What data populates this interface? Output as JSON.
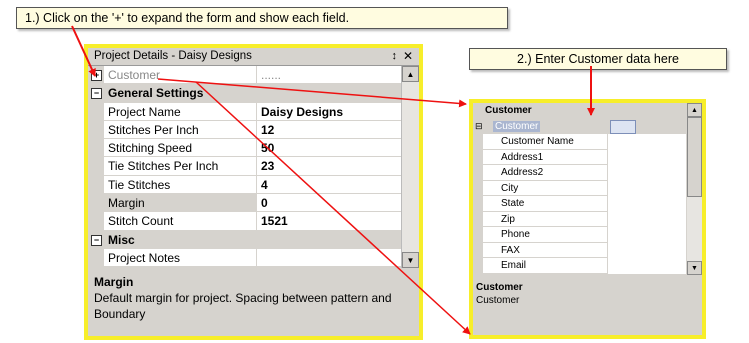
{
  "callouts": {
    "step1": "1.) Click on the '+' to expand the form and show each field.",
    "step2": "2.)  Enter Customer data here"
  },
  "panel": {
    "title": "Project Details - Daisy Designs",
    "customer_label": "Customer",
    "customer_value": "......",
    "categories": {
      "general": "General Settings",
      "misc": "Misc"
    },
    "rows": [
      {
        "label": "Project Name",
        "value": "Daisy Designs"
      },
      {
        "label": "Stitches Per Inch",
        "value": "12"
      },
      {
        "label": "Stitching Speed",
        "value": "50"
      },
      {
        "label": "Tie Stitches Per Inch",
        "value": "23"
      },
      {
        "label": "Tie Stitches",
        "value": "4"
      },
      {
        "label": "Margin",
        "value": "0"
      },
      {
        "label": "Stitch Count",
        "value": "1521"
      }
    ],
    "project_notes": "Project Notes",
    "description_title": "Margin",
    "description_text": "Default margin for project. Spacing between pattern and Boundary"
  },
  "customer_panel": {
    "category": "Customer",
    "selected": "Customer",
    "selected_value": ".......",
    "fields": [
      "Customer Name",
      "Address1",
      "Address2",
      "City",
      "State",
      "Zip",
      "Phone",
      "FAX",
      "Email"
    ],
    "description_title": "Customer",
    "description_text": "Customer"
  },
  "colors": {
    "highlight_border": "#f7ee2a",
    "arrow": "#ee1111"
  }
}
